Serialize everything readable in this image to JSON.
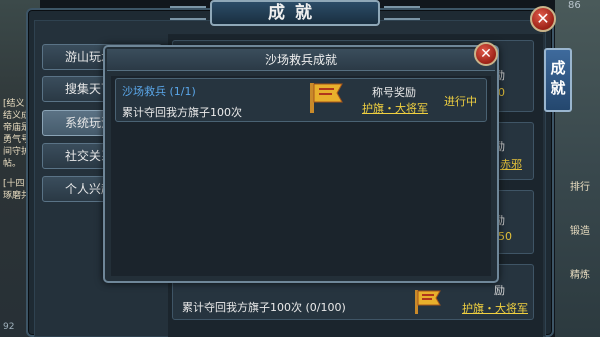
{
  "window": {
    "title": "成就",
    "close_icon": "close-icon",
    "top_right_counter": "86"
  },
  "categories": [
    {
      "label": "游山玩水",
      "active": false
    },
    {
      "label": "搜集天下",
      "active": false
    },
    {
      "label": "系统玩法",
      "active": true
    },
    {
      "label": "社交关系",
      "active": false
    },
    {
      "label": "个人兴趣",
      "active": false
    }
  ],
  "side_tab": {
    "label": "成就"
  },
  "side_icons": [
    "排行",
    "锻造",
    "精炼"
  ],
  "chat": [
    "[结义",
    "结义成",
    "帝庙是",
    "勇气号",
    "间守护",
    "帖。",
    "[十四",
    "琢磨共"
  ],
  "background_cards": {
    "rewards": [
      "励",
      "0",
      "励",
      "赤邪",
      "励",
      "50",
      "励"
    ],
    "bottom_desc": "累计夺回我方旗子100次 (0/100)",
    "bottom_reward": "护旗・大将军"
  },
  "popup": {
    "title": "沙场救兵成就",
    "achievement": {
      "name": "沙场救兵",
      "progress": "(1/1)",
      "description": "累计夺回我方旗子100次",
      "reward_label": "称号奖励",
      "reward_value": "护旗・大将军",
      "status": "进行中"
    }
  },
  "bottom_left_counter": "92"
}
